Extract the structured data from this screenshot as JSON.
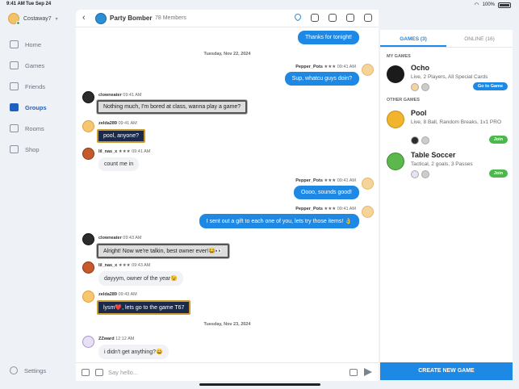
{
  "status": {
    "time": "9:41 AM",
    "date": "Tue Sep 24",
    "battery": "100%"
  },
  "sidebar": {
    "username": "Costaway7",
    "items": [
      {
        "label": "Home",
        "icon": "home-icon"
      },
      {
        "label": "Games",
        "icon": "gamepad-icon"
      },
      {
        "label": "Friends",
        "icon": "person-icon"
      },
      {
        "label": "Groups",
        "icon": "group-icon",
        "active": true
      },
      {
        "label": "Rooms",
        "icon": "chat-icon"
      },
      {
        "label": "Shop",
        "icon": "shop-icon"
      }
    ],
    "settings": "Settings"
  },
  "chat": {
    "group_name": "Party Bomber",
    "member_count": "78 Members",
    "composer_placeholder": "Say hello...",
    "date1": "Tuesday, Nov 22, 2024",
    "date2": "Tuesday, Nov 23, 2024",
    "messages": [
      {
        "id": "m0",
        "text": "Thanks for tonight!"
      },
      {
        "id": "m1",
        "user": "Pepper_Pots",
        "time": "09:41 AM",
        "text": "Sup, whatcu guys doin?"
      },
      {
        "id": "m2",
        "user": "clowneater",
        "time": "09:41 AM",
        "text": "Nothing much, I'm bored at class, wanna play a game?"
      },
      {
        "id": "m3",
        "user": "zelda289",
        "time": "09:41 AM",
        "text": "pool, anyone?"
      },
      {
        "id": "m4",
        "user": "lil_nas_x",
        "time": "09:41 AM",
        "text": "count me in"
      },
      {
        "id": "m5",
        "user": "Pepper_Pots",
        "time": "09:41 AM",
        "text": "Oooo, sounds good!"
      },
      {
        "id": "m6",
        "user": "Pepper_Pots",
        "time": "09:41 AM",
        "text": "I sent out a gift to each one of you, lets try those items! 👌"
      },
      {
        "id": "m7",
        "user": "clowneater",
        "time": "09:43 AM",
        "text": "Alright! Now we're talkin, best owner ever!😂👀"
      },
      {
        "id": "m8",
        "user": "lil_nas_x",
        "time": "09:43 AM",
        "text": "dayyym, owner of the year😉"
      },
      {
        "id": "m9",
        "user": "zelda289",
        "time": "09:43 AM",
        "text": "lysm❤️, lets go to the game T67"
      },
      {
        "id": "m10",
        "user": "ZZward",
        "time": "12:12 AM",
        "text": "i didn't get anything?😄"
      }
    ]
  },
  "games_panel": {
    "tab_games": "GAMES (3)",
    "tab_online": "ONLINE (16)",
    "my_games_label": "MY GAMES",
    "other_games_label": "OTHER GAMES",
    "games": [
      {
        "title": "Ocho",
        "desc": "Live, 2 Players, All Special Cards",
        "button": "Go to Game",
        "color": "#1b1b1b"
      },
      {
        "title": "Pool",
        "desc": "Live, 8 Ball, Random Breaks, 1v1 PRO",
        "button": "Join",
        "color": "#f0b52a"
      },
      {
        "title": "Table Soccer",
        "desc": "Tactical, 2 goals, 3 Passes",
        "button": "Join",
        "color": "#5cb84c"
      }
    ],
    "create_button": "CREATE NEW GAME"
  }
}
